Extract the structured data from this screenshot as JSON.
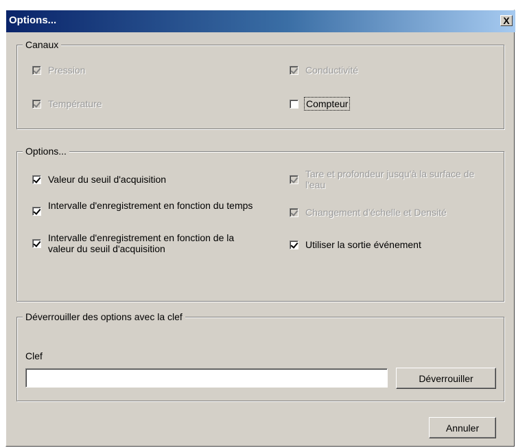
{
  "window": {
    "title": "Options...",
    "close_label": "X"
  },
  "channels": {
    "legend": "Canaux",
    "items": [
      {
        "label": "Pression",
        "checked": true,
        "enabled": false
      },
      {
        "label": "Température",
        "checked": true,
        "enabled": false
      },
      {
        "label": "Conductivité",
        "checked": true,
        "enabled": false
      },
      {
        "label": "Compteur",
        "checked": false,
        "enabled": true
      }
    ]
  },
  "options": {
    "legend": "Options...",
    "items": [
      {
        "label": "Valeur du seuil d'acquisition",
        "checked": true,
        "enabled": true
      },
      {
        "label": "Intervalle d'enregistrement en fonction du temps",
        "checked": true,
        "enabled": true
      },
      {
        "label": "Intervalle d'enregistrement en fonction de la valeur du seuil d'acquisition",
        "checked": true,
        "enabled": true
      },
      {
        "label": "Tare et profondeur jusqu'à la surface de l'eau",
        "checked": true,
        "enabled": false
      },
      {
        "label": "Changement d'échelle et Densité",
        "checked": true,
        "enabled": false
      },
      {
        "label": "Utiliser la sortie événement",
        "checked": true,
        "enabled": true
      }
    ]
  },
  "unlock": {
    "legend": "Déverrouiller des options avec la clef",
    "key_label": "Clef",
    "key_value": "",
    "unlock_button": "Déverrouiller"
  },
  "footer": {
    "cancel_button": "Annuler"
  }
}
